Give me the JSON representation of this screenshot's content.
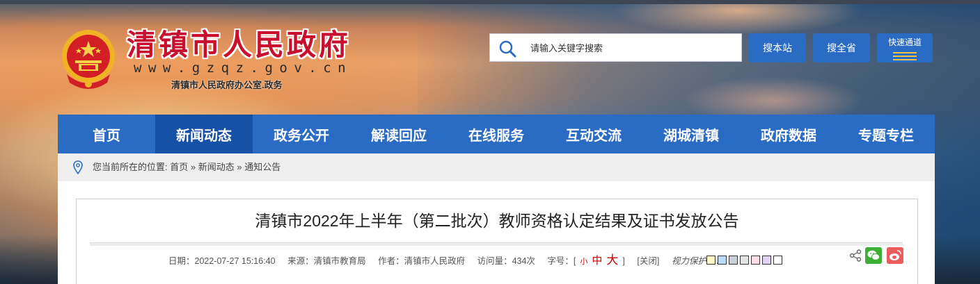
{
  "header": {
    "site_title": "清镇市人民政府",
    "site_url": "www.gzqz.gov.cn",
    "site_subtitle": "清镇市人民政府办公室.政务",
    "emblem_icon": "national-emblem-icon"
  },
  "search": {
    "placeholder": "请输入关键字搜索",
    "value": "",
    "btn_site": "搜本站",
    "btn_province": "搜全省",
    "btn_fast": "快速通道"
  },
  "nav": {
    "items": [
      {
        "label": "首页"
      },
      {
        "label": "新闻动态"
      },
      {
        "label": "政务公开"
      },
      {
        "label": "解读回应"
      },
      {
        "label": "在线服务"
      },
      {
        "label": "互动交流"
      },
      {
        "label": "湖城清镇"
      },
      {
        "label": "政府数据"
      },
      {
        "label": "专题专栏"
      }
    ],
    "active": "新闻动态"
  },
  "breadcrumb": {
    "prefix": "您当前所在的位置:",
    "items": [
      "首页",
      "新闻动态",
      "通知公告"
    ],
    "separator": "»"
  },
  "article": {
    "title": "清镇市2022年上半年（第二批次）教师资格认定结果及证书发放公告",
    "date": "日期：2022-07-27 15:16:40",
    "source": "来源：清镇市教育局",
    "author": "作者：清镇市人民政府",
    "views": "访问量：434次",
    "font_label": "字号：[",
    "font_small": "小",
    "font_medium": "中",
    "font_large": "大",
    "font_end": "]",
    "close": "[关闭]",
    "eye_label": "视力保护色：",
    "swatch_colors": [
      "#fdf7c7",
      "#bcd9f5",
      "#c9cfd6",
      "#e5e5e5",
      "#fbdce8",
      "#e2d2f6",
      "#ffffff"
    ]
  },
  "colors": {
    "nav_bg": "#2a6cc4",
    "nav_active": "#1751a6",
    "title_red": "#c8102e",
    "wechat": "#3cb034",
    "weibo": "#ea5d5c"
  }
}
